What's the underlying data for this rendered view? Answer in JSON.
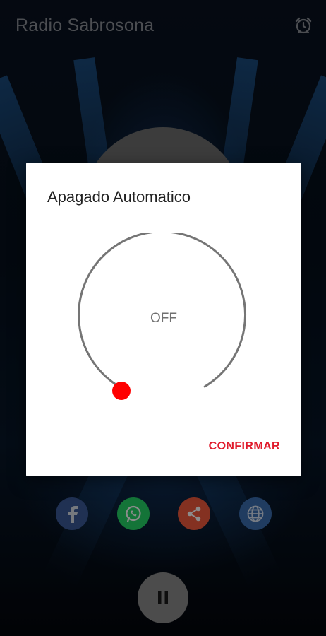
{
  "app": {
    "title": "Radio Sabrosona"
  },
  "dialog": {
    "title": "Apagado Automatico",
    "timer_value": "OFF",
    "confirm_label": "CONFIRMAR"
  },
  "icons": {
    "alarm": "alarm-clock-icon",
    "facebook": "facebook-icon",
    "whatsapp": "whatsapp-icon",
    "share": "share-icon",
    "web": "globe-icon",
    "pause": "pause-icon"
  },
  "colors": {
    "accent": "#e01b2c",
    "facebook": "#3b5998",
    "whatsapp": "#25d366",
    "share": "#f05a3c",
    "web": "#3b6db0"
  }
}
